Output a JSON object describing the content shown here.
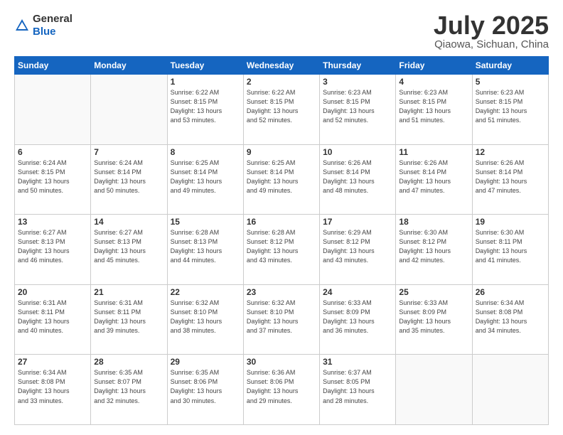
{
  "header": {
    "logo_line1": "General",
    "logo_line2": "Blue",
    "month": "July 2025",
    "location": "Qiaowa, Sichuan, China"
  },
  "weekdays": [
    "Sunday",
    "Monday",
    "Tuesday",
    "Wednesday",
    "Thursday",
    "Friday",
    "Saturday"
  ],
  "weeks": [
    [
      {
        "day": "",
        "info": ""
      },
      {
        "day": "",
        "info": ""
      },
      {
        "day": "1",
        "info": "Sunrise: 6:22 AM\nSunset: 8:15 PM\nDaylight: 13 hours\nand 53 minutes."
      },
      {
        "day": "2",
        "info": "Sunrise: 6:22 AM\nSunset: 8:15 PM\nDaylight: 13 hours\nand 52 minutes."
      },
      {
        "day": "3",
        "info": "Sunrise: 6:23 AM\nSunset: 8:15 PM\nDaylight: 13 hours\nand 52 minutes."
      },
      {
        "day": "4",
        "info": "Sunrise: 6:23 AM\nSunset: 8:15 PM\nDaylight: 13 hours\nand 51 minutes."
      },
      {
        "day": "5",
        "info": "Sunrise: 6:23 AM\nSunset: 8:15 PM\nDaylight: 13 hours\nand 51 minutes."
      }
    ],
    [
      {
        "day": "6",
        "info": "Sunrise: 6:24 AM\nSunset: 8:15 PM\nDaylight: 13 hours\nand 50 minutes."
      },
      {
        "day": "7",
        "info": "Sunrise: 6:24 AM\nSunset: 8:14 PM\nDaylight: 13 hours\nand 50 minutes."
      },
      {
        "day": "8",
        "info": "Sunrise: 6:25 AM\nSunset: 8:14 PM\nDaylight: 13 hours\nand 49 minutes."
      },
      {
        "day": "9",
        "info": "Sunrise: 6:25 AM\nSunset: 8:14 PM\nDaylight: 13 hours\nand 49 minutes."
      },
      {
        "day": "10",
        "info": "Sunrise: 6:26 AM\nSunset: 8:14 PM\nDaylight: 13 hours\nand 48 minutes."
      },
      {
        "day": "11",
        "info": "Sunrise: 6:26 AM\nSunset: 8:14 PM\nDaylight: 13 hours\nand 47 minutes."
      },
      {
        "day": "12",
        "info": "Sunrise: 6:26 AM\nSunset: 8:14 PM\nDaylight: 13 hours\nand 47 minutes."
      }
    ],
    [
      {
        "day": "13",
        "info": "Sunrise: 6:27 AM\nSunset: 8:13 PM\nDaylight: 13 hours\nand 46 minutes."
      },
      {
        "day": "14",
        "info": "Sunrise: 6:27 AM\nSunset: 8:13 PM\nDaylight: 13 hours\nand 45 minutes."
      },
      {
        "day": "15",
        "info": "Sunrise: 6:28 AM\nSunset: 8:13 PM\nDaylight: 13 hours\nand 44 minutes."
      },
      {
        "day": "16",
        "info": "Sunrise: 6:28 AM\nSunset: 8:12 PM\nDaylight: 13 hours\nand 43 minutes."
      },
      {
        "day": "17",
        "info": "Sunrise: 6:29 AM\nSunset: 8:12 PM\nDaylight: 13 hours\nand 43 minutes."
      },
      {
        "day": "18",
        "info": "Sunrise: 6:30 AM\nSunset: 8:12 PM\nDaylight: 13 hours\nand 42 minutes."
      },
      {
        "day": "19",
        "info": "Sunrise: 6:30 AM\nSunset: 8:11 PM\nDaylight: 13 hours\nand 41 minutes."
      }
    ],
    [
      {
        "day": "20",
        "info": "Sunrise: 6:31 AM\nSunset: 8:11 PM\nDaylight: 13 hours\nand 40 minutes."
      },
      {
        "day": "21",
        "info": "Sunrise: 6:31 AM\nSunset: 8:11 PM\nDaylight: 13 hours\nand 39 minutes."
      },
      {
        "day": "22",
        "info": "Sunrise: 6:32 AM\nSunset: 8:10 PM\nDaylight: 13 hours\nand 38 minutes."
      },
      {
        "day": "23",
        "info": "Sunrise: 6:32 AM\nSunset: 8:10 PM\nDaylight: 13 hours\nand 37 minutes."
      },
      {
        "day": "24",
        "info": "Sunrise: 6:33 AM\nSunset: 8:09 PM\nDaylight: 13 hours\nand 36 minutes."
      },
      {
        "day": "25",
        "info": "Sunrise: 6:33 AM\nSunset: 8:09 PM\nDaylight: 13 hours\nand 35 minutes."
      },
      {
        "day": "26",
        "info": "Sunrise: 6:34 AM\nSunset: 8:08 PM\nDaylight: 13 hours\nand 34 minutes."
      }
    ],
    [
      {
        "day": "27",
        "info": "Sunrise: 6:34 AM\nSunset: 8:08 PM\nDaylight: 13 hours\nand 33 minutes."
      },
      {
        "day": "28",
        "info": "Sunrise: 6:35 AM\nSunset: 8:07 PM\nDaylight: 13 hours\nand 32 minutes."
      },
      {
        "day": "29",
        "info": "Sunrise: 6:35 AM\nSunset: 8:06 PM\nDaylight: 13 hours\nand 30 minutes."
      },
      {
        "day": "30",
        "info": "Sunrise: 6:36 AM\nSunset: 8:06 PM\nDaylight: 13 hours\nand 29 minutes."
      },
      {
        "day": "31",
        "info": "Sunrise: 6:37 AM\nSunset: 8:05 PM\nDaylight: 13 hours\nand 28 minutes."
      },
      {
        "day": "",
        "info": ""
      },
      {
        "day": "",
        "info": ""
      }
    ]
  ]
}
